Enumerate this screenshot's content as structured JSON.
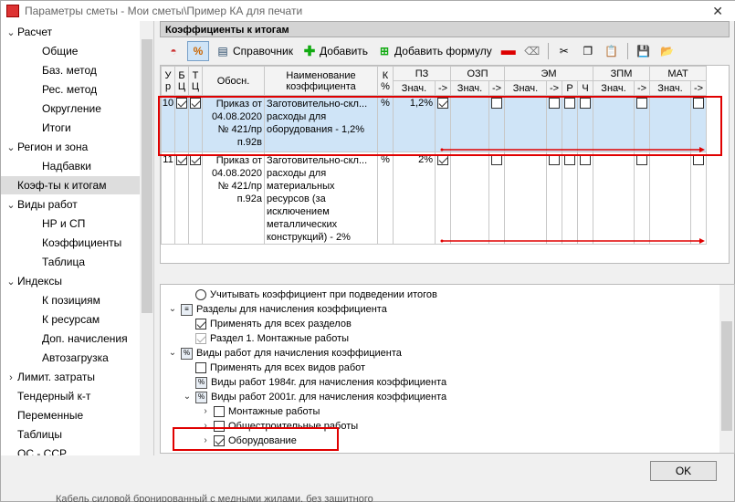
{
  "window": {
    "title": "Параметры сметы - Мои сметы\\Пример КА для печати"
  },
  "sidebar": {
    "items": [
      {
        "label": "Расчет",
        "level": 0,
        "expander": "expanded"
      },
      {
        "label": "Общие",
        "level": 1
      },
      {
        "label": "Баз. метод",
        "level": 1
      },
      {
        "label": "Рес. метод",
        "level": 1
      },
      {
        "label": "Округление",
        "level": 1
      },
      {
        "label": "Итоги",
        "level": 1
      },
      {
        "label": "Регион и зона",
        "level": 0,
        "expander": "expanded"
      },
      {
        "label": "Надбавки",
        "level": 1
      },
      {
        "label": "Коэф-ты к итогам",
        "level": 0,
        "selected": true
      },
      {
        "label": "Виды работ",
        "level": 0,
        "expander": "expanded"
      },
      {
        "label": "НР и СП",
        "level": 1
      },
      {
        "label": "Коэффициенты",
        "level": 1
      },
      {
        "label": "Таблица",
        "level": 1
      },
      {
        "label": "Индексы",
        "level": 0,
        "expander": "expanded"
      },
      {
        "label": "К позициям",
        "level": 1
      },
      {
        "label": "К ресурсам",
        "level": 1
      },
      {
        "label": "Доп. начисления",
        "level": 1
      },
      {
        "label": "Автозагрузка",
        "level": 1
      },
      {
        "label": "Лимит. затраты",
        "level": 0,
        "expander": "collapsed"
      },
      {
        "label": "Тендерный к-т",
        "level": 0
      },
      {
        "label": "Переменные",
        "level": 0
      },
      {
        "label": "Таблицы",
        "level": 0
      },
      {
        "label": "ОС - ССР",
        "level": 0
      }
    ]
  },
  "panel": {
    "title": "Коэффициенты к итогам"
  },
  "toolbar": {
    "reference_label": "Справочник",
    "add_label": "Добавить",
    "add_formula_label": "Добавить формулу"
  },
  "table": {
    "headers": {
      "ur": "У р",
      "bc": "Б Ц",
      "tc": "Т Ц",
      "basis": "Обосн.",
      "name": "Наименование коэффициента",
      "kpct": "К %",
      "pz": "ПЗ",
      "ozp": "ОЗП",
      "em": "ЭМ",
      "zpm": "ЗПМ",
      "mat": "МАТ",
      "val": "Знач.",
      "arrow": "->",
      "r": "Р",
      "ch": "Ч"
    },
    "rows": [
      {
        "num": "10",
        "basis": "Приказ от 04.08.2020 № 421/пр п.92в",
        "name": "Заготовительно-скл... расходы для оборудования - 1,2%",
        "kpct": "%",
        "pz_val": "1,2%"
      },
      {
        "num": "11",
        "basis": "Приказ от 04.08.2020 № 421/пр п.92а",
        "name": "Заготовительно-скл... расходы для материальных ресурсов (за исключением металлических конструкций) - 2%",
        "kpct": "%",
        "pz_val": "2%"
      }
    ]
  },
  "tree": {
    "items": [
      {
        "label": "Учитывать коэффициент при подведении итогов",
        "type": "radio"
      },
      {
        "label": "Разделы для начисления коэффициента",
        "type": "group-list"
      },
      {
        "label": "Применять для всех разделов",
        "type": "check",
        "checked": true
      },
      {
        "label": "Раздел 1. Монтажные работы",
        "type": "check-gray",
        "checked": true
      },
      {
        "label": "Виды работ для начисления коэффициента",
        "type": "group-pct"
      },
      {
        "label": "Применять для всех видов работ",
        "type": "check",
        "checked": false
      },
      {
        "label": "Виды работ 1984г. для начисления коэффициента",
        "type": "pct"
      },
      {
        "label": "Виды работ 2001г. для начисления коэффициента",
        "type": "group-pct"
      },
      {
        "label": "Монтажные работы",
        "type": "check",
        "checked": false
      },
      {
        "label": "Общестроительные работы",
        "type": "check",
        "checked": false
      },
      {
        "label": "Оборудование",
        "type": "check",
        "checked": true
      }
    ]
  },
  "footer": {
    "ok_label": "OK",
    "background_text": "Кабель силовой бронированный с медными жилами, без защитного"
  },
  "colors": {
    "highlight": "#e00000",
    "selected_row": "#cfe4f7"
  }
}
